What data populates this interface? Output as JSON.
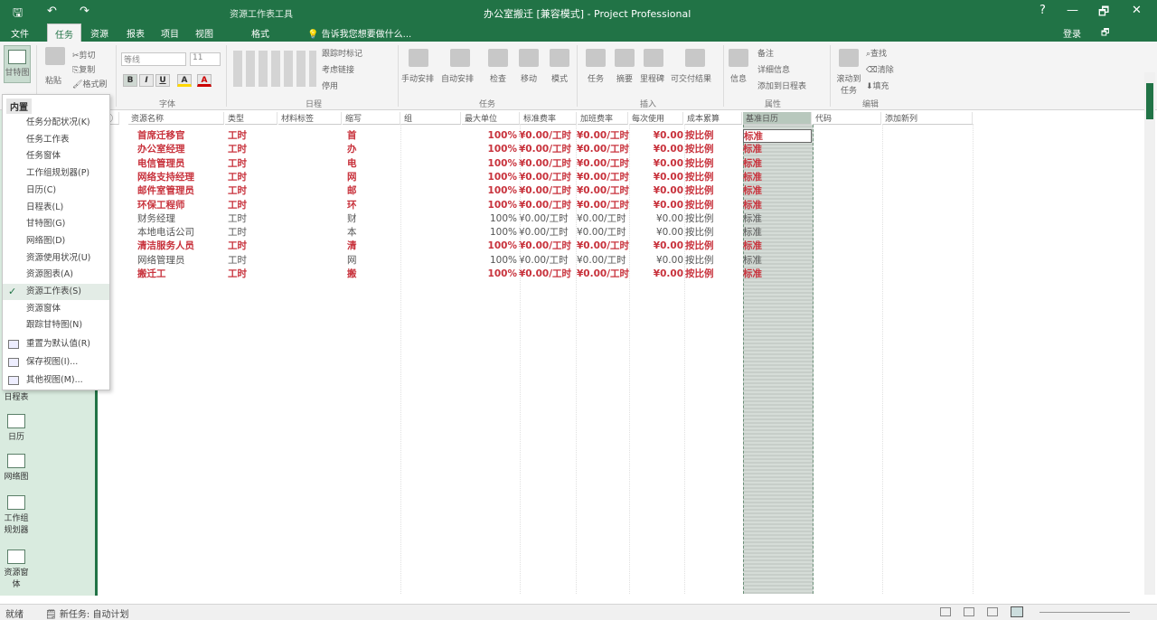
{
  "titlebar": {
    "context_tab": "资源工作表工具",
    "document_title": "办公室搬迁 [兼容模式] - Project Professional",
    "qat": {
      "save": "🖫",
      "undo": "↶",
      "redo": "↷"
    },
    "window_buttons": {
      "help": "?",
      "minimize": "—",
      "restore": "🗗",
      "close": "✕"
    }
  },
  "tabs": {
    "file": "文件",
    "task": "任务",
    "resource": "资源",
    "report": "报表",
    "project": "项目",
    "view": "视图",
    "format": "格式",
    "tell_me": "告诉我您想要做什么...",
    "signin": "登录",
    "restore": "🗗"
  },
  "ribbon": {
    "view_button": "甘特图",
    "clipboard": {
      "paste": "粘贴",
      "cut": "剪切",
      "copy": "复制",
      "format_painter": "格式刷"
    },
    "font": {
      "name": "等线",
      "size": "11",
      "bold": "B",
      "italic": "I",
      "underline": "U",
      "fill": "A",
      "color": "A",
      "label": "字体"
    },
    "schedule": {
      "mark_on_track": "跟踪时标记",
      "respect_links": "考虑链接",
      "inactivate": "停用",
      "label": "日程"
    },
    "tasks": {
      "manual": "手动安排",
      "auto": "自动安排",
      "inspect": "检查",
      "move": "移动",
      "mode": "模式",
      "label": "任务"
    },
    "insert": {
      "task": "任务",
      "summary": "摘要",
      "milestone": "里程碑",
      "deliverable": "可交付结果",
      "label": "插入"
    },
    "properties": {
      "info": "信息",
      "notes": "备注",
      "details": "详细信息",
      "add_to_timeline": "添加到日程表",
      "label": "属性"
    },
    "editing": {
      "scroll_to_task": "滚动到任务",
      "find": "查找",
      "clear": "清除",
      "fill": "填充",
      "label": "编辑"
    }
  },
  "view_menu": {
    "header": "内置",
    "items": [
      {
        "label": "任务分配状况(K)",
        "checked": false
      },
      {
        "label": "任务工作表",
        "checked": false
      },
      {
        "label": "任务窗体",
        "checked": false
      },
      {
        "label": "工作组规划器(P)",
        "checked": false
      },
      {
        "label": "日历(C)",
        "checked": false
      },
      {
        "label": "日程表(L)",
        "checked": false
      },
      {
        "label": "甘特图(G)",
        "checked": false
      },
      {
        "label": "网络图(D)",
        "checked": false
      },
      {
        "label": "资源使用状况(U)",
        "checked": false
      },
      {
        "label": "资源图表(A)",
        "checked": false
      },
      {
        "label": "资源工作表(S)",
        "checked": true
      },
      {
        "label": "资源窗体",
        "checked": false
      },
      {
        "label": "跟踪甘特图(N)",
        "checked": false
      }
    ],
    "actions": [
      "重置为默认值(R)",
      "保存视图(I)...",
      "其他视图(M)..."
    ],
    "check_mark": "✓"
  },
  "left_views": [
    {
      "label": "日程表"
    },
    {
      "label": "日历"
    },
    {
      "label": "网络图"
    },
    {
      "label": "工作组规划器"
    },
    {
      "label": "资源窗体"
    }
  ],
  "sheet": {
    "columns": [
      "资源名称",
      "类型",
      "材料标签",
      "缩写",
      "组",
      "最大单位",
      "标准费率",
      "加班费率",
      "每次使用",
      "成本累算",
      "基准日历",
      "代码",
      "添加新列"
    ],
    "rows": [
      {
        "name": "首席迁移官",
        "type": "工时",
        "abbr": "首",
        "max": "100%",
        "std": "¥0.00/工时",
        "ovt": "¥0.00/工时",
        "cost": "¥0.00",
        "accrue": "按比例",
        "cal": "标准",
        "style": "red"
      },
      {
        "name": "办公室经理",
        "type": "工时",
        "abbr": "办",
        "max": "100%",
        "std": "¥0.00/工时",
        "ovt": "¥0.00/工时",
        "cost": "¥0.00",
        "accrue": "按比例",
        "cal": "标准",
        "style": "red"
      },
      {
        "name": "电信管理员",
        "type": "工时",
        "abbr": "电",
        "max": "100%",
        "std": "¥0.00/工时",
        "ovt": "¥0.00/工时",
        "cost": "¥0.00",
        "accrue": "按比例",
        "cal": "标准",
        "style": "red"
      },
      {
        "name": "网络支持经理",
        "type": "工时",
        "abbr": "网",
        "max": "100%",
        "std": "¥0.00/工时",
        "ovt": "¥0.00/工时",
        "cost": "¥0.00",
        "accrue": "按比例",
        "cal": "标准",
        "style": "red"
      },
      {
        "name": "邮件室管理员",
        "type": "工时",
        "abbr": "邮",
        "max": "100%",
        "std": "¥0.00/工时",
        "ovt": "¥0.00/工时",
        "cost": "¥0.00",
        "accrue": "按比例",
        "cal": "标准",
        "style": "red"
      },
      {
        "name": "环保工程师",
        "type": "工时",
        "abbr": "环",
        "max": "100%",
        "std": "¥0.00/工时",
        "ovt": "¥0.00/工时",
        "cost": "¥0.00",
        "accrue": "按比例",
        "cal": "标准",
        "style": "red"
      },
      {
        "name": "财务经理",
        "type": "工时",
        "abbr": "财",
        "max": "100%",
        "std": "¥0.00/工时",
        "ovt": "¥0.00/工时",
        "cost": "¥0.00",
        "accrue": "按比例",
        "cal": "标准",
        "style": "gray"
      },
      {
        "name": "本地电话公司",
        "type": "工时",
        "abbr": "本",
        "max": "100%",
        "std": "¥0.00/工时",
        "ovt": "¥0.00/工时",
        "cost": "¥0.00",
        "accrue": "按比例",
        "cal": "标准",
        "style": "gray"
      },
      {
        "name": "清洁服务人员",
        "type": "工时",
        "abbr": "清",
        "max": "100%",
        "std": "¥0.00/工时",
        "ovt": "¥0.00/工时",
        "cost": "¥0.00",
        "accrue": "按比例",
        "cal": "标准",
        "style": "red"
      },
      {
        "name": "网络管理员",
        "type": "工时",
        "abbr": "网",
        "max": "100%",
        "std": "¥0.00/工时",
        "ovt": "¥0.00/工时",
        "cost": "¥0.00",
        "accrue": "按比例",
        "cal": "标准",
        "style": "gray"
      },
      {
        "name": "搬迁工",
        "type": "工时",
        "abbr": "搬",
        "max": "100%",
        "std": "¥0.00/工时",
        "ovt": "¥0.00/工时",
        "cost": "¥0.00",
        "accrue": "按比例",
        "cal": "标准",
        "style": "red"
      }
    ]
  },
  "status": {
    "ready": "就绪",
    "new_tasks": "新任务: 自动计划"
  }
}
